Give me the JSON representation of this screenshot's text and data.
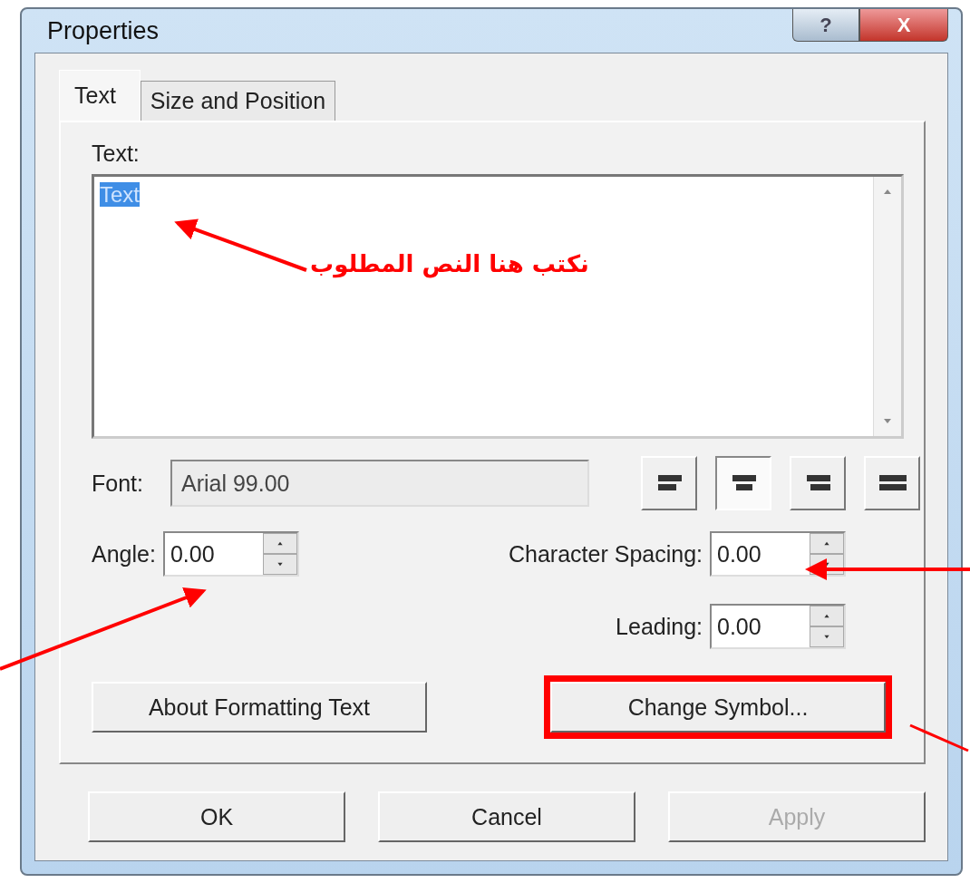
{
  "window": {
    "title": "Properties",
    "help_button": "?",
    "close_button": "X"
  },
  "tabs": [
    {
      "label": "Text",
      "selected": true
    },
    {
      "label": "Size and Position",
      "selected": false
    }
  ],
  "text_field": {
    "label": "Text:",
    "value": "Text",
    "value_selected": true
  },
  "font": {
    "label": "Font:",
    "value": "Arial 99.00"
  },
  "alignment_buttons": [
    {
      "kind": "left",
      "selected": false
    },
    {
      "kind": "center",
      "selected": true
    },
    {
      "kind": "right",
      "selected": false
    },
    {
      "kind": "full",
      "selected": false
    }
  ],
  "angle": {
    "label": "Angle:",
    "value": "0.00"
  },
  "character_spacing": {
    "label": "Character Spacing:",
    "value": "0.00"
  },
  "leading": {
    "label": "Leading:",
    "value": "0.00"
  },
  "about_button": {
    "label": "About Formatting Text"
  },
  "change_symbol_button": {
    "label": "Change Symbol...",
    "highlighted": true
  },
  "footer_buttons": [
    {
      "label": "OK",
      "disabled": false
    },
    {
      "label": "Cancel",
      "disabled": false
    },
    {
      "label": "Apply",
      "disabled": true
    }
  ],
  "annotation": {
    "text": "نكتب هنا النص المطلوب"
  }
}
